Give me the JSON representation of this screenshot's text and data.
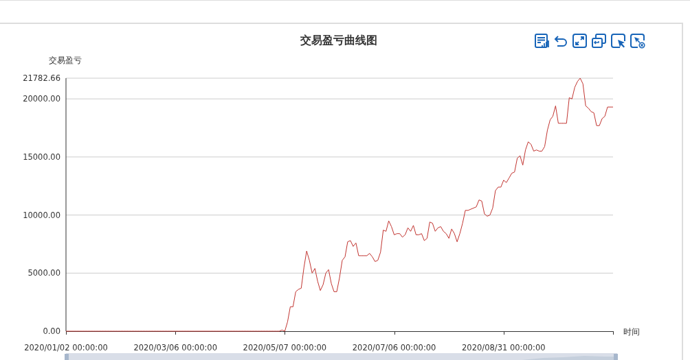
{
  "chart": {
    "chart_data": {
      "type": "line",
      "title": "交易盈亏曲线图",
      "xlabel": "时间",
      "ylabel": "交易盈亏",
      "categories": [
        "2020/01/02 00:00:00",
        null,
        null,
        null,
        null,
        null,
        null,
        null,
        null,
        null,
        null,
        null,
        null,
        null,
        null,
        null,
        null,
        null,
        null,
        null,
        null,
        null,
        null,
        null,
        null,
        null,
        null,
        null,
        null,
        null,
        null,
        null,
        null,
        null,
        null,
        null,
        null,
        null,
        null,
        null,
        "2020/03/06 00:00:00",
        null,
        null,
        null,
        null,
        null,
        null,
        null,
        null,
        null,
        null,
        null,
        null,
        null,
        null,
        null,
        null,
        null,
        null,
        null,
        null,
        null,
        null,
        null,
        null,
        null,
        null,
        null,
        null,
        null,
        null,
        null,
        null,
        null,
        null,
        null,
        null,
        null,
        null,
        null,
        "2020/05/07 00:00:00",
        null,
        null,
        null,
        null,
        null,
        null,
        null,
        null,
        null,
        null,
        null,
        null,
        null,
        null,
        null,
        null,
        null,
        null,
        null,
        null,
        null,
        null,
        null,
        null,
        null,
        null,
        null,
        null,
        null,
        null,
        null,
        null,
        null,
        null,
        null,
        null,
        null,
        null,
        null,
        "2020/07/06 00:00:00",
        null,
        null,
        null,
        null,
        null,
        null,
        null,
        null,
        null,
        null,
        null,
        null,
        null,
        null,
        null,
        null,
        null,
        null,
        null,
        null,
        null,
        null,
        null,
        null,
        null,
        null,
        null,
        null,
        null,
        null,
        null,
        null,
        null,
        null,
        null,
        null,
        null,
        null,
        null,
        "2020/08/31 00:00:00",
        null,
        null,
        null,
        null,
        null,
        null,
        null,
        null,
        null,
        null,
        null,
        null,
        null,
        null,
        null,
        null,
        null,
        null,
        null,
        null,
        null,
        null,
        null,
        null,
        null,
        null,
        null,
        null,
        null,
        null,
        null,
        null,
        null,
        null,
        null,
        null,
        null,
        null,
        null,
        null
      ],
      "series": [
        {
          "color": "#c23531",
          "values": [
            0,
            0,
            0,
            0,
            0,
            0,
            0,
            0,
            0,
            0,
            0,
            0,
            0,
            0,
            0,
            0,
            0,
            0,
            0,
            0,
            0,
            0,
            0,
            0,
            0,
            0,
            0,
            0,
            0,
            0,
            0,
            0,
            0,
            0,
            0,
            0,
            0,
            0,
            0,
            0,
            0,
            0,
            0,
            0,
            0,
            0,
            0,
            0,
            0,
            0,
            0,
            0,
            0,
            0,
            0,
            0,
            0,
            0,
            0,
            0,
            0,
            0,
            0,
            0,
            0,
            0,
            0,
            0,
            0,
            0,
            0,
            0,
            0,
            0,
            0,
            0,
            0,
            0,
            0,
            100,
            0,
            800,
            2100,
            2100,
            3400,
            3600,
            3700,
            5500,
            6900,
            6100,
            5000,
            5400,
            4300,
            3500,
            4000,
            5000,
            5300,
            4100,
            3400,
            3400,
            4600,
            6100,
            6400,
            7700,
            7800,
            7300,
            7600,
            6500,
            6500,
            6500,
            6500,
            6700,
            6400,
            6000,
            6100,
            6800,
            8700,
            8600,
            9500,
            9000,
            8300,
            8400,
            8400,
            8100,
            8300,
            8900,
            8600,
            9100,
            8300,
            8300,
            8400,
            7800,
            8000,
            9400,
            9300,
            8600,
            8900,
            9000,
            8600,
            8400,
            8000,
            8800,
            8400,
            7700,
            8400,
            9300,
            10400,
            10400,
            10500,
            10600,
            10700,
            11300,
            11200,
            10100,
            9900,
            10000,
            10600,
            12100,
            12400,
            12400,
            13000,
            12800,
            13200,
            13600,
            13700,
            14900,
            15100,
            14300,
            15600,
            16300,
            16100,
            15500,
            15600,
            15500,
            15500,
            15900,
            17300,
            18200,
            18500,
            19400,
            17900,
            17900,
            17900,
            17900,
            20100,
            20000,
            21000,
            21500,
            21780,
            21300,
            19400,
            19200,
            18900,
            18800,
            17700,
            17700,
            18300,
            18500,
            19300,
            19300,
            19300
          ]
        }
      ],
      "ylim": [
        0,
        21782.66
      ],
      "grid": true,
      "yticks": [
        {
          "value": 0,
          "label": "0.00"
        },
        {
          "value": 5000,
          "label": "5000.00"
        },
        {
          "value": 10000,
          "label": "10000.00"
        },
        {
          "value": 15000,
          "label": "15000.00"
        },
        {
          "value": 20000,
          "label": "20000.00"
        },
        {
          "value": 21782.66,
          "label": "21782.66"
        }
      ]
    }
  }
}
